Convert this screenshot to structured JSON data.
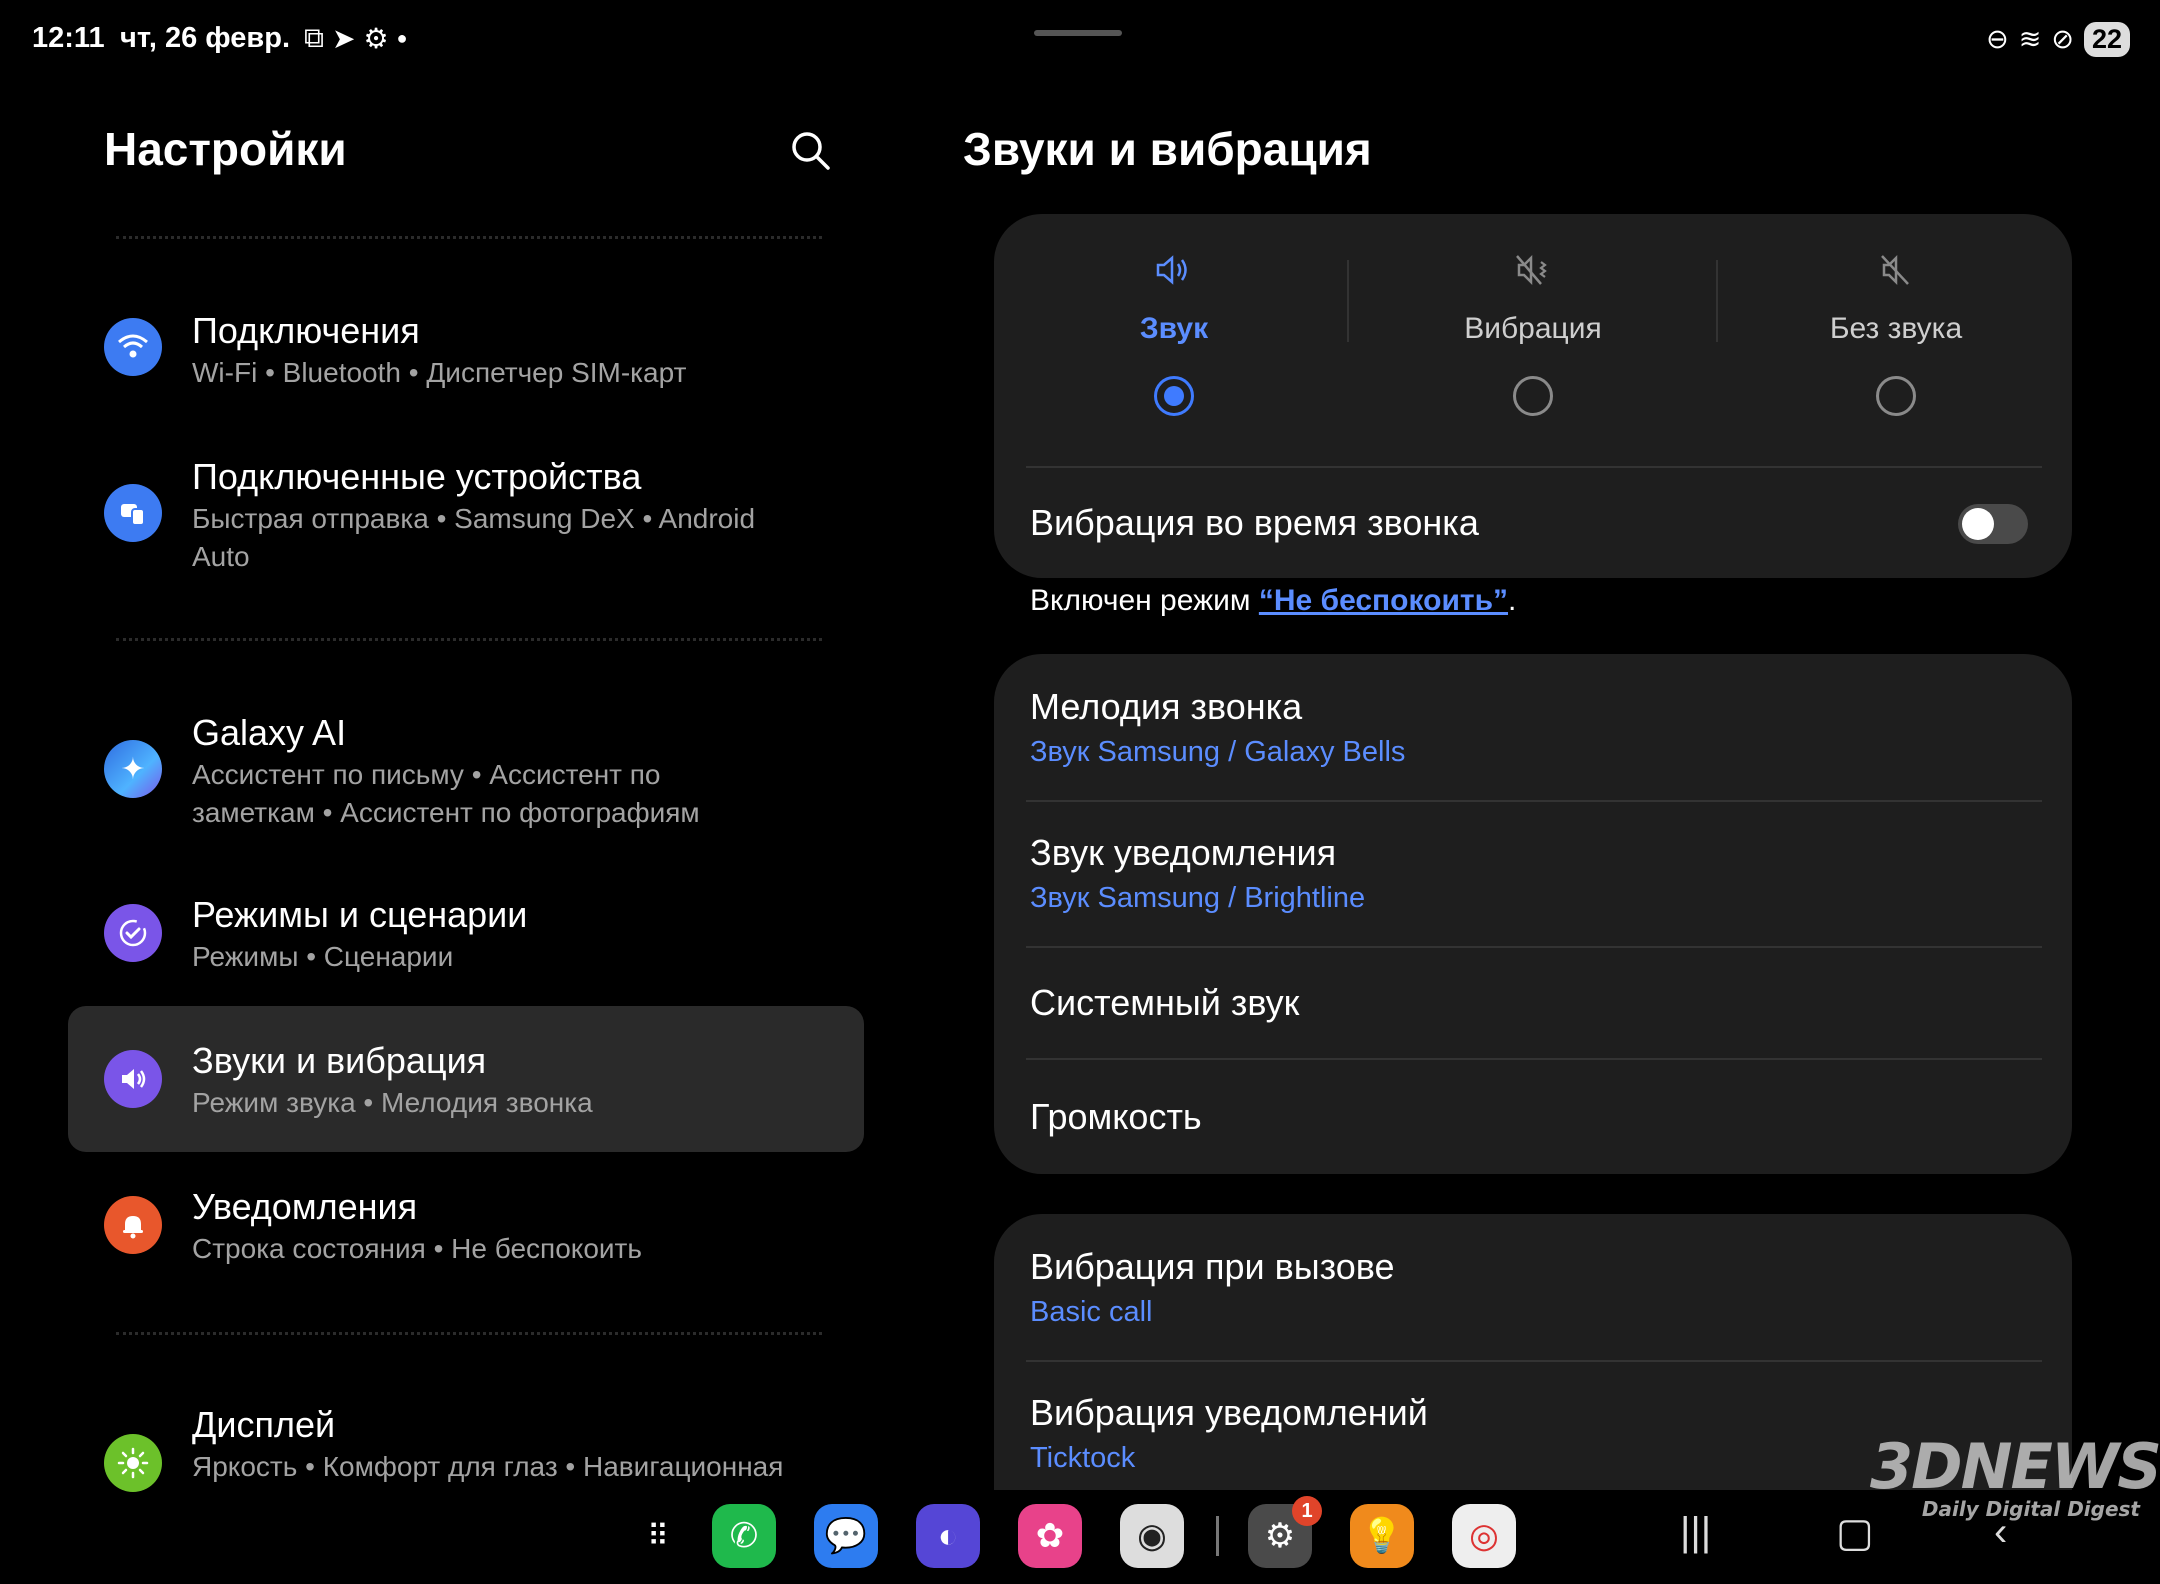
{
  "status_bar": {
    "time": "12:11",
    "date": "чт, 26 февр.",
    "battery": "22"
  },
  "left": {
    "title": "Настройки",
    "items": [
      {
        "title": "Подключения",
        "subtitle": "Wi-Fi  •  Bluetooth  •  Диспетчер SIM-карт",
        "icon": "wifi-icon",
        "color": "#3d7bf2"
      },
      {
        "title": "Подключенные устройства",
        "subtitle": "Быстрая отправка  •  Samsung DeX  •  Android Auto",
        "icon": "devices-icon",
        "color": "#3d7bf2"
      },
      {
        "title": "Galaxy AI",
        "subtitle": "Ассистент по письму  •  Ассистент по заметкам  •  Ассистент по фотографиям",
        "icon": "galaxy-ai-icon",
        "color": "#2f6ce0"
      },
      {
        "title": "Режимы и сценарии",
        "subtitle": "Режимы  •  Сценарии",
        "icon": "modes-icon",
        "color": "#7a55e8"
      },
      {
        "title": "Звуки и вибрация",
        "subtitle": "Режим звука  •  Мелодия звонка",
        "icon": "sound-icon",
        "color": "#7a55e8"
      },
      {
        "title": "Уведомления",
        "subtitle": "Строка состояния  •  Не беспокоить",
        "icon": "bell-icon",
        "color": "#e8572c"
      },
      {
        "title": "Дисплей",
        "subtitle": "Яркость  •  Комфорт для глаз  •  Навигационная",
        "icon": "sun-icon",
        "color": "#6cc12a"
      }
    ]
  },
  "right": {
    "title": "Звуки и вибрация",
    "modes": [
      {
        "label": "Звук",
        "icon": "speaker-icon",
        "selected": true
      },
      {
        "label": "Вибрация",
        "icon": "vibrate-icon",
        "selected": false
      },
      {
        "label": "Без звука",
        "icon": "mute-icon",
        "selected": false
      }
    ],
    "vibrate_during_call": "Вибрация во время звонка",
    "vibrate_during_call_on": false,
    "dnd_prefix": "Включен режим ",
    "dnd_link": "“Не беспокоить”",
    "dnd_suffix": ".",
    "sound_rows": [
      {
        "title": "Мелодия звонка",
        "subtitle": "Звук Samsung / Galaxy Bells"
      },
      {
        "title": "Звук уведомления",
        "subtitle": "Звук Samsung / Brightline"
      },
      {
        "title": "Системный звук",
        "subtitle": ""
      },
      {
        "title": "Громкость",
        "subtitle": ""
      }
    ],
    "vibration_rows": [
      {
        "title": "Вибрация при вызове",
        "subtitle": "Basic call"
      },
      {
        "title": "Вибрация уведомлений",
        "subtitle": "Ticktock"
      }
    ],
    "accent": "#5b8dff"
  },
  "dock": {
    "settings_badge": "1"
  },
  "watermark": {
    "logo": "3DNEWS",
    "tagline": "Daily Digital Digest"
  }
}
